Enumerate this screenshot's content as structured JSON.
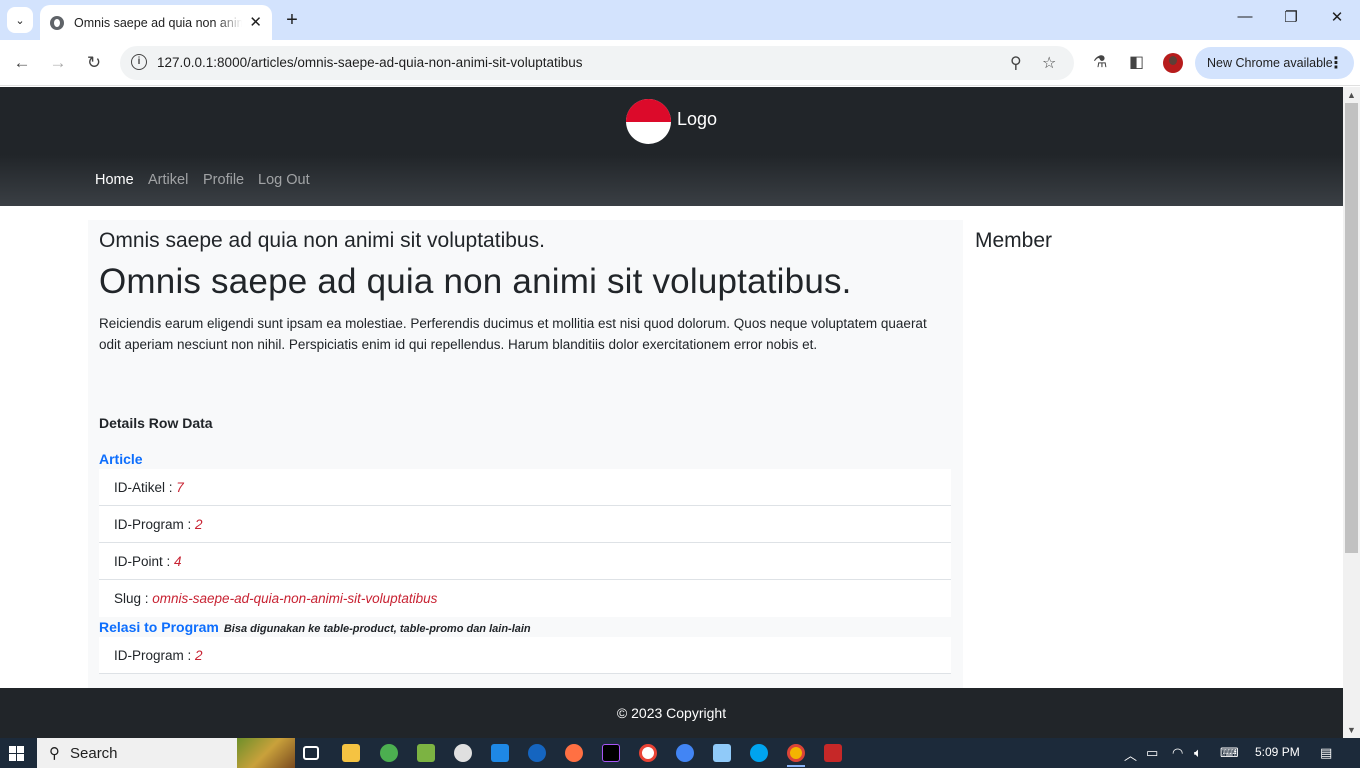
{
  "browser": {
    "tab_title": "Omnis saepe ad quia non animi sit voluptatibus.",
    "tab_close": "✕",
    "new_tab": "+",
    "url": "127.0.0.1:8000/articles/omnis-saepe-ad-quia-non-animi-sit-voluptatibus",
    "update_label": "New Chrome available",
    "minimize": "—",
    "restore": "❐",
    "close": "✕"
  },
  "site": {
    "logo_text": "Logo",
    "nav": [
      "Home",
      "Artikel",
      "Profile",
      "Log Out"
    ],
    "active_nav": "Home"
  },
  "article": {
    "heading_small": "Omnis saepe ad quia non animi sit voluptatibus.",
    "heading_big": "Omnis saepe ad quia non animi sit voluptatibus.",
    "body": "Reiciendis earum eligendi sunt ipsam ea molestiae. Perferendis ducimus et mollitia est nisi quod dolorum. Quos neque voluptatem quaerat odit aperiam nesciunt non nihil. Perspiciatis enim id qui repellendus. Harum blanditiis dolor exercitationem error nobis et."
  },
  "details": {
    "title": "Details Row Data",
    "article_section": {
      "title": "Article",
      "rows": [
        {
          "label": "ID-Atikel : ",
          "value": "7"
        },
        {
          "label": "ID-Program : ",
          "value": "2"
        },
        {
          "label": "ID-Point : ",
          "value": "4"
        },
        {
          "label": "Slug : ",
          "value": "omnis-saepe-ad-quia-non-animi-sit-voluptatibus"
        }
      ]
    },
    "relasi_section": {
      "title": "Relasi to Program",
      "note": "Bisa digunakan ke table-product, table-promo dan lain-lain",
      "rows": [
        {
          "label": "ID-Program : ",
          "value": "2"
        }
      ]
    }
  },
  "sidebar": {
    "title": "Member"
  },
  "footer": {
    "text": "© 2023 Copyright"
  },
  "taskbar": {
    "search_label": "Search",
    "time": "5:09 PM"
  },
  "colors": {
    "header_bg": "#212529",
    "link_blue": "#0d6efd",
    "value_red": "#c82333",
    "logo_red": "#dc0a2a"
  }
}
